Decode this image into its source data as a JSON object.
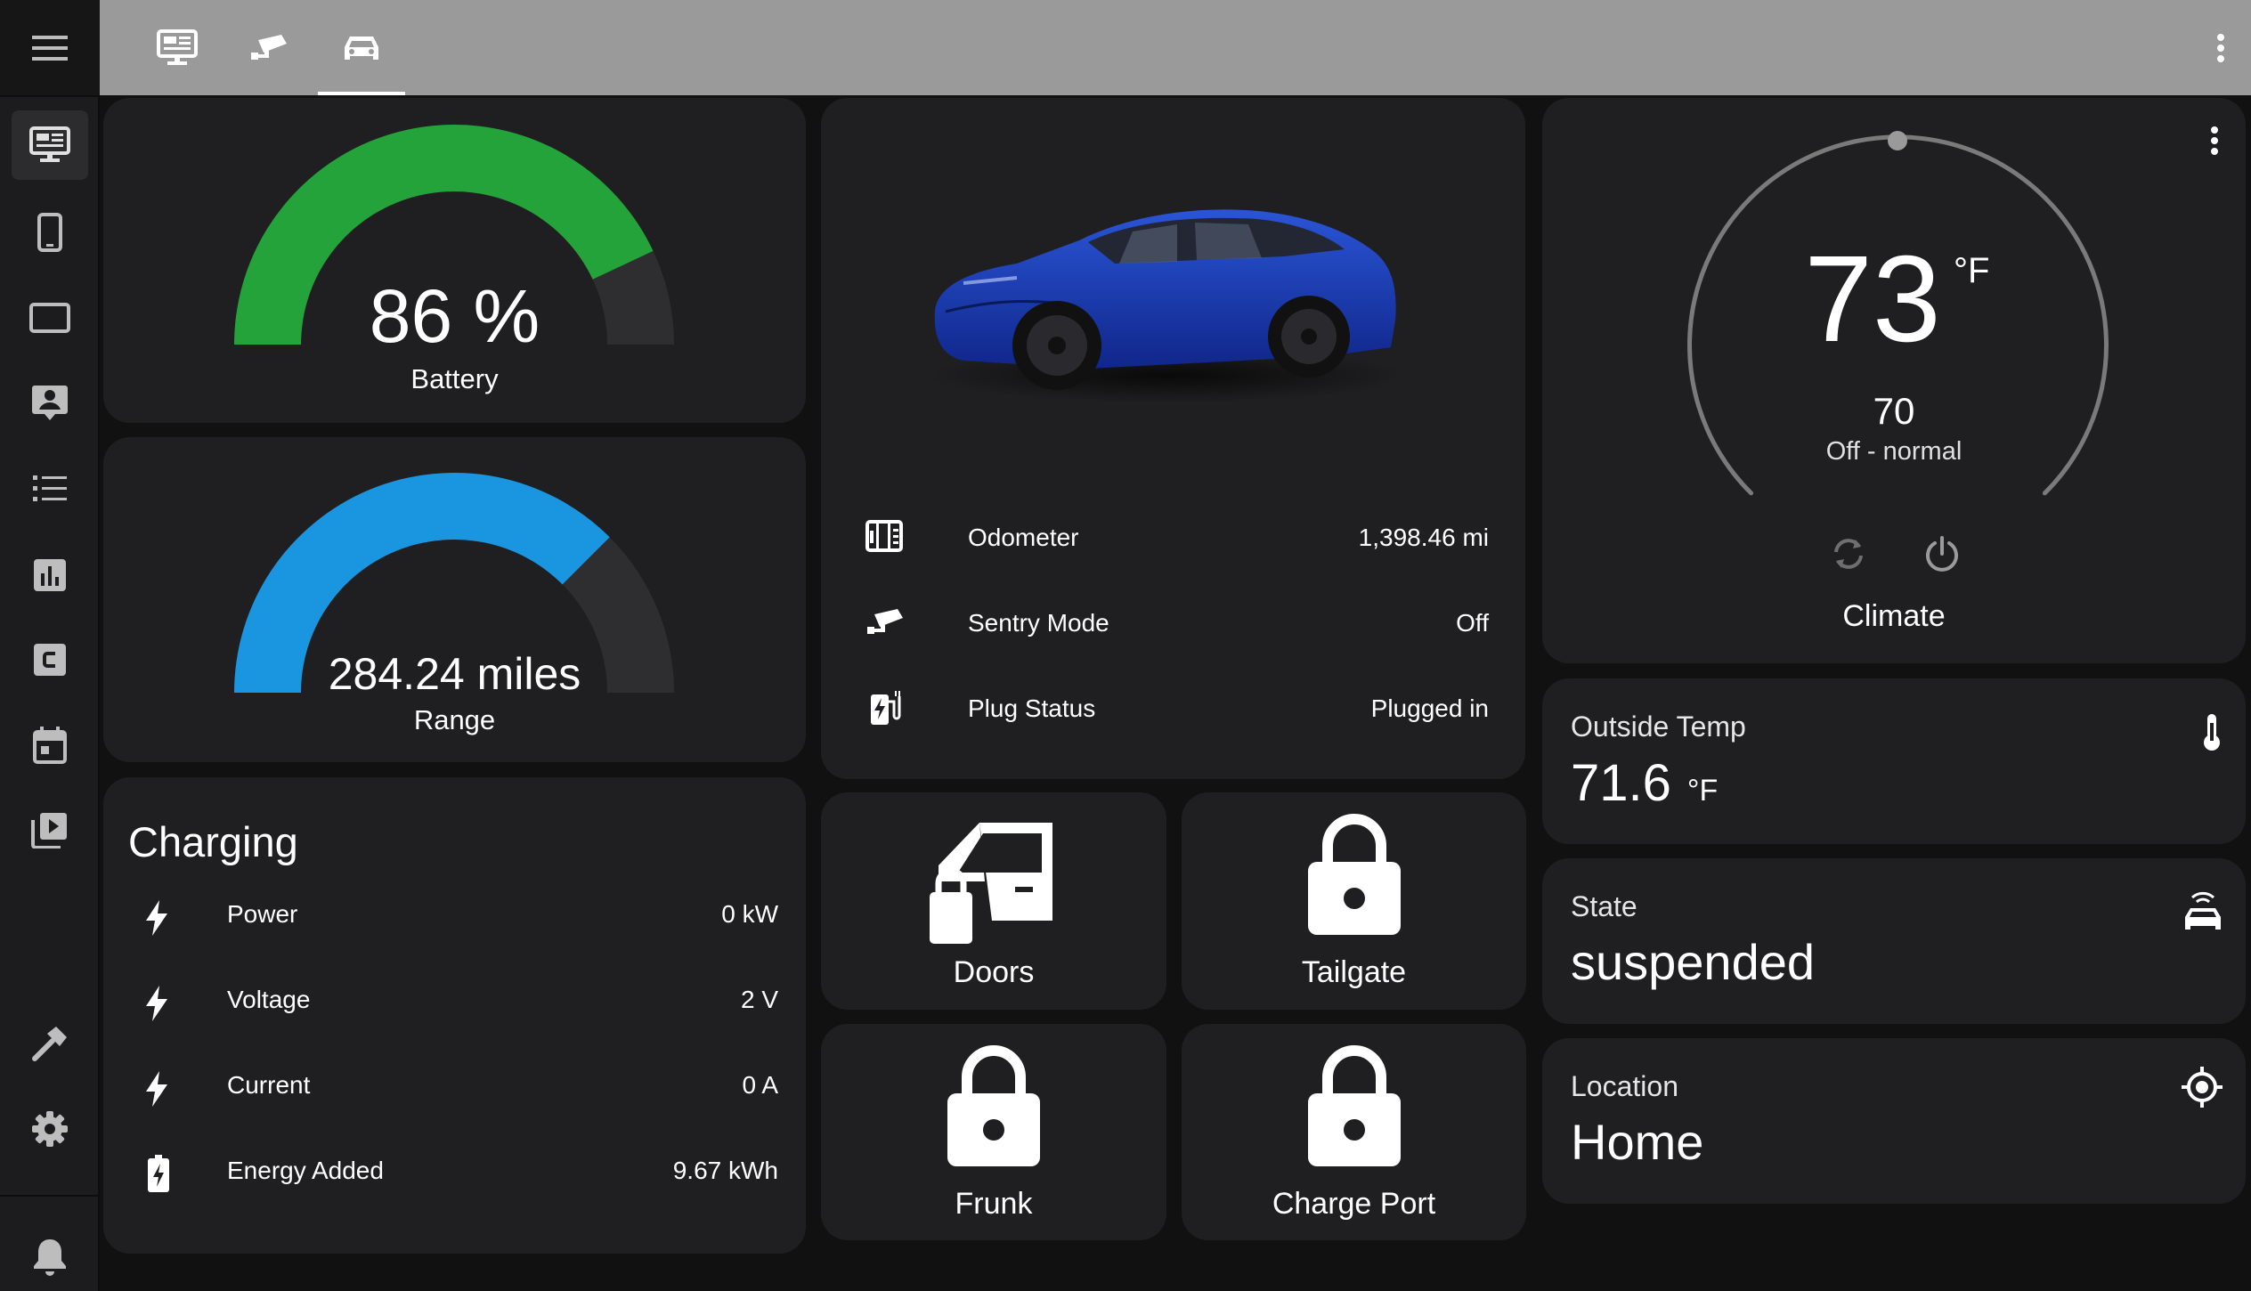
{
  "topbar": {
    "tabs": [
      {
        "icon": "monitor-dashboard-icon"
      },
      {
        "icon": "cctv-icon"
      },
      {
        "icon": "car-icon",
        "active": true
      }
    ],
    "menu_icon": "dots-vertical-icon"
  },
  "sidebar": {
    "menu_icon": "hamburger-menu-icon",
    "items": [
      {
        "icon": "monitor-dashboard-icon",
        "active": true
      },
      {
        "icon": "cellphone-icon"
      },
      {
        "icon": "tablet-icon"
      },
      {
        "icon": "account-box-icon"
      },
      {
        "icon": "format-list-icon"
      },
      {
        "icon": "chart-box-icon"
      },
      {
        "icon": "alpha-c-box-icon"
      },
      {
        "icon": "calendar-icon"
      },
      {
        "icon": "play-box-multiple-icon"
      }
    ],
    "bottom_items": [
      {
        "icon": "hammer-icon"
      },
      {
        "icon": "cog-icon"
      },
      {
        "icon": "bell-icon"
      }
    ]
  },
  "battery": {
    "value": "86 %",
    "label": "Battery",
    "level": 0.86,
    "color": "#23a33a"
  },
  "range": {
    "value": "284.24 miles",
    "label": "Range",
    "level": 0.75,
    "color": "#1a95e0"
  },
  "charging": {
    "title": "Charging",
    "rows": [
      {
        "icon": "flash-icon",
        "label": "Power",
        "value": "0 kW"
      },
      {
        "icon": "flash-icon",
        "label": "Voltage",
        "value": "2 V"
      },
      {
        "icon": "flash-icon",
        "label": "Current",
        "value": "0 A"
      },
      {
        "icon": "battery-charging-icon",
        "label": "Energy Added",
        "value": "9.67 kWh"
      }
    ]
  },
  "car": {
    "color": "#1a3fb8",
    "rows": [
      {
        "icon": "counter-icon",
        "label": "Odometer",
        "value": "1,398.46 mi"
      },
      {
        "icon": "cctv-icon",
        "label": "Sentry Mode",
        "value": "Off"
      },
      {
        "icon": "ev-plug-icon",
        "label": "Plug Status",
        "value": "Plugged in"
      }
    ]
  },
  "tiles": [
    {
      "icon": "car-door-lock-icon",
      "label": "Doors"
    },
    {
      "icon": "lock-icon",
      "label": "Tailgate"
    },
    {
      "icon": "lock-icon",
      "label": "Frunk"
    },
    {
      "icon": "lock-icon",
      "label": "Charge Port"
    }
  ],
  "climate": {
    "current": "73",
    "unit": "°F",
    "target": "70",
    "mode": "Off - normal",
    "name": "Climate",
    "menu_icon": "dots-vertical-icon",
    "mode_icon": "autorenew-icon",
    "power_icon": "power-icon"
  },
  "outside_temp": {
    "title": "Outside Temp",
    "value": "71.6",
    "unit": "°F",
    "icon": "thermometer-icon"
  },
  "state": {
    "title": "State",
    "value": "suspended",
    "icon": "car-connected-icon"
  },
  "location": {
    "title": "Location",
    "value": "Home",
    "icon": "crosshairs-gps-icon"
  }
}
